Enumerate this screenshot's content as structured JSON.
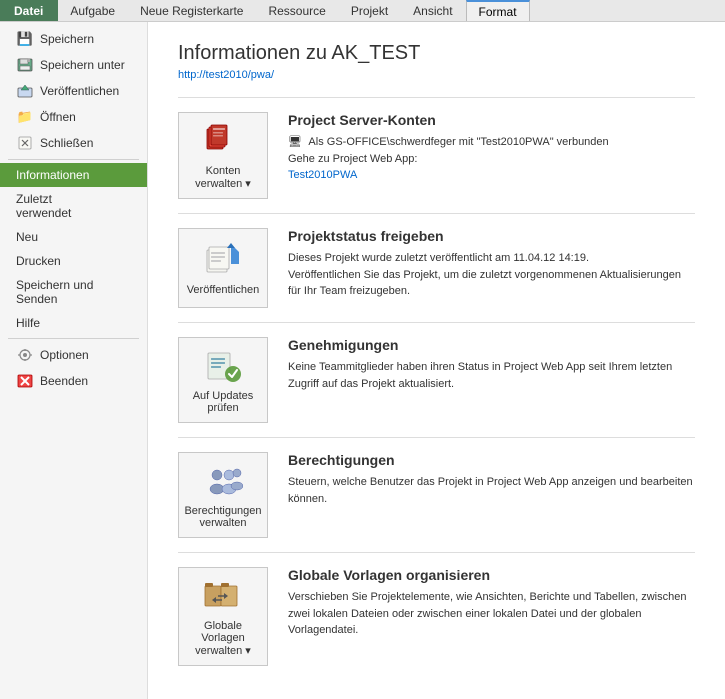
{
  "menuBar": {
    "items": [
      {
        "id": "datei",
        "label": "Datei",
        "active": false,
        "isFile": true
      },
      {
        "id": "aufgabe",
        "label": "Aufgabe",
        "active": false
      },
      {
        "id": "neue-registerkarte",
        "label": "Neue Registerkarte",
        "active": false
      },
      {
        "id": "ressource",
        "label": "Ressource",
        "active": false
      },
      {
        "id": "projekt",
        "label": "Projekt",
        "active": false
      },
      {
        "id": "ansicht",
        "label": "Ansicht",
        "active": false
      },
      {
        "id": "format",
        "label": "Format",
        "active": true
      }
    ]
  },
  "sidebar": {
    "items": [
      {
        "id": "speichern",
        "label": "Speichern",
        "icon": "💾",
        "active": false
      },
      {
        "id": "speichern-unter",
        "label": "Speichern unter",
        "icon": "🗄",
        "active": false
      },
      {
        "id": "veroffentlichen",
        "label": "Veröffentlichen",
        "icon": "📤",
        "active": false
      },
      {
        "id": "offnen",
        "label": "Öffnen",
        "icon": "📁",
        "active": false
      },
      {
        "id": "schliessen",
        "label": "Schließen",
        "icon": "📄",
        "active": false
      },
      {
        "id": "informationen",
        "label": "Informationen",
        "icon": "",
        "active": true
      },
      {
        "id": "zuletzt-verwendet",
        "label": "Zuletzt\nverwendet",
        "icon": "",
        "active": false
      },
      {
        "id": "neu",
        "label": "Neu",
        "icon": "",
        "active": false
      },
      {
        "id": "drucken",
        "label": "Drucken",
        "icon": "",
        "active": false
      },
      {
        "id": "speichern-senden",
        "label": "Speichern und\nSenden",
        "icon": "",
        "active": false
      },
      {
        "id": "hilfe",
        "label": "Hilfe",
        "icon": "",
        "active": false
      },
      {
        "id": "optionen",
        "label": "Optionen",
        "icon": "⚙",
        "active": false
      },
      {
        "id": "beenden",
        "label": "Beenden",
        "icon": "✖",
        "active": false
      }
    ]
  },
  "content": {
    "title": "Informationen zu AK_TEST",
    "subtitle": "http://test2010/pwa/",
    "sections": [
      {
        "id": "konten",
        "iconLabel": "Konten\nverwalten ▾",
        "title": "Project Server-Konten",
        "desc1": "Als GS-OFFICE\\schwerdfeger mit \"Test2010PWA\" verbunden",
        "desc2": "Gehe zu Project Web App:",
        "link": "Test2010PWA",
        "hasSmallIcon": true
      },
      {
        "id": "veroffentlichen",
        "iconLabel": "Veröffentlichen",
        "title": "Projektstatus freigeben",
        "desc1": "Dieses Projekt wurde zuletzt veröffentlicht am 11.04.12 14:19.",
        "desc2": "Veröffentlichen Sie das Projekt, um die zuletzt vorgenommenen Aktualisierungen für Ihr Team freizugeben.",
        "link": "",
        "hasSmallIcon": false
      },
      {
        "id": "genehmigungen",
        "iconLabel": "Auf Updates\nprüfen",
        "title": "Genehmigungen",
        "desc1": "Keine Teammitglieder haben ihren Status in Project Web App seit Ihrem letzten Zugriff auf das Projekt aktualisiert.",
        "desc2": "",
        "link": "",
        "hasSmallIcon": false
      },
      {
        "id": "berechtigungen",
        "iconLabel": "Berechtigungen\nverwalten",
        "title": "Berechtigungen",
        "desc1": "Steuern, welche Benutzer das Projekt in Project Web App anzeigen und bearbeiten können.",
        "desc2": "",
        "link": "",
        "hasSmallIcon": false
      },
      {
        "id": "vorlagen",
        "iconLabel": "Globale Vorlagen\nverwalten ▾",
        "title": "Globale Vorlagen organisieren",
        "desc1": "Verschieben Sie Projektelemente, wie Ansichten, Berichte und Tabellen, zwischen zwei lokalen Dateien oder zwischen einer lokalen Datei und der globalen Vorlagendatei.",
        "desc2": "",
        "link": "",
        "hasSmallIcon": false
      }
    ]
  }
}
